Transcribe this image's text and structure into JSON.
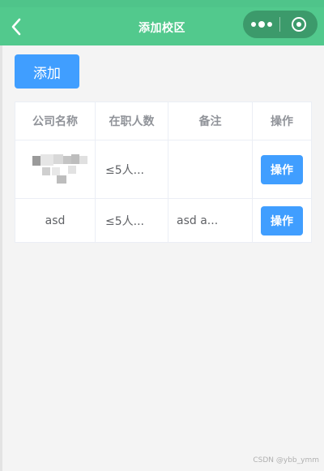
{
  "nav": {
    "title": "添加校区",
    "back_icon": "chevron-left-icon",
    "more_icon": "more-dots-icon",
    "close_icon": "target-close-icon"
  },
  "actions": {
    "add_label": "添加"
  },
  "table": {
    "headers": [
      "公司名称",
      "在职人数",
      "备注",
      "操作"
    ],
    "rows": [
      {
        "company": "",
        "staff": "≤5人...",
        "note": "",
        "action": "操作"
      },
      {
        "company": "asd",
        "staff": "≤5人...",
        "note": "asd a...",
        "action": "操作"
      }
    ]
  },
  "watermark": "CSDN @ybb_ymm",
  "colors": {
    "header_green": "#52c98d",
    "capsule": "#3c9a6b",
    "primary_blue": "#409eff",
    "background": "#f4f4f4"
  }
}
